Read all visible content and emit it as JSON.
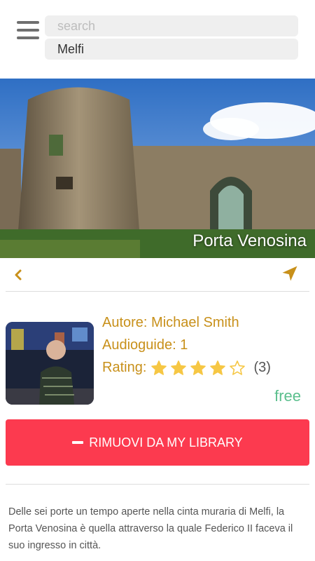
{
  "search": {
    "placeholder": "search",
    "city": "Melfi"
  },
  "hero": {
    "title": "Porta Venosina"
  },
  "guide": {
    "author": "Autore: Michael Smith",
    "audioguides": "Audioguide: 1",
    "rating_label": "Rating:",
    "rating_stars": 4,
    "rating_max": 5,
    "rating_count": "(3)",
    "price": "free"
  },
  "actions": {
    "remove_label": "RIMUOVI DA MY LIBRARY",
    "back_icon": "chevron-left-icon",
    "navigate_icon": "navigation-arrow-icon"
  },
  "description": "Delle sei porte un tempo aperte nella cinta muraria di Melfi, la Porta Venosina è quella attraverso la quale Federico II faceva il suo ingresso in città.",
  "colors": {
    "accent": "#c8901a",
    "remove": "#fc3a4f",
    "price": "#5bbf8d",
    "star": "#f6c744"
  }
}
